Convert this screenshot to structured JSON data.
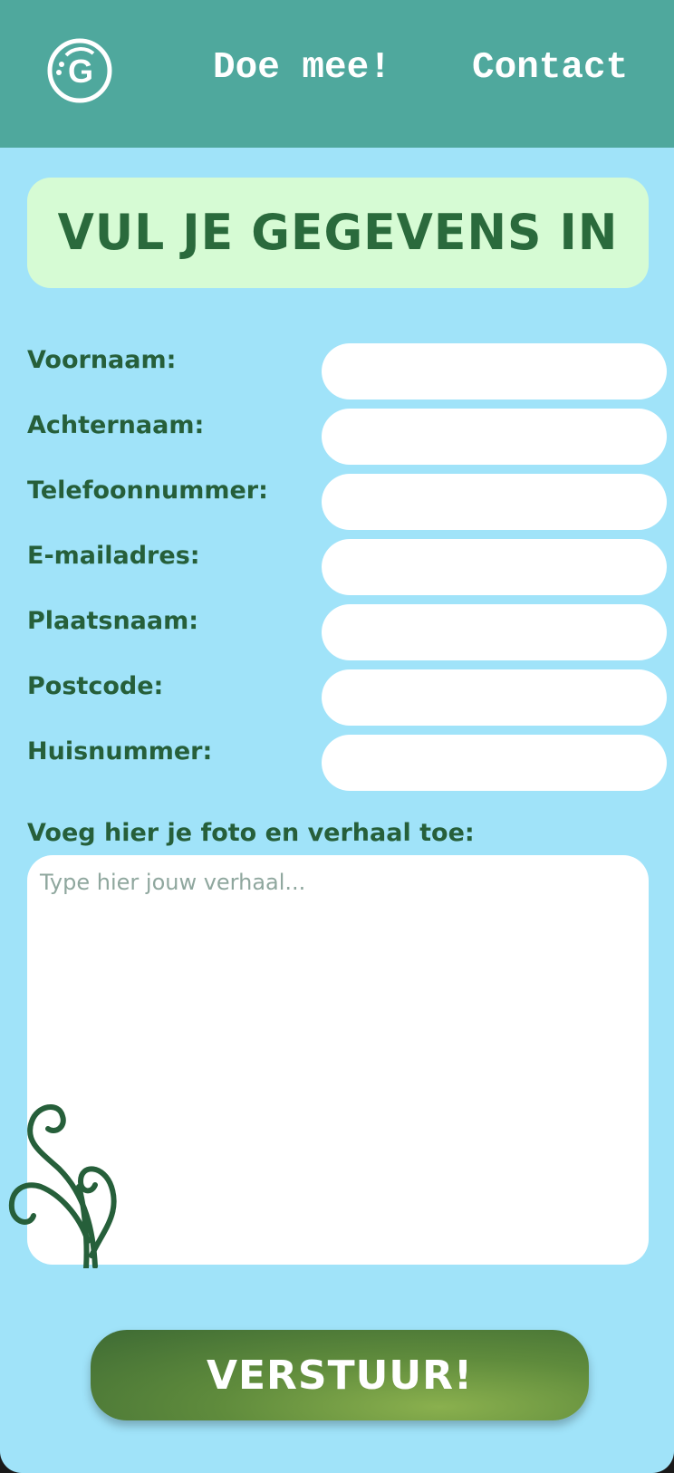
{
  "header": {
    "logo_letter": "G",
    "nav": [
      {
        "label": "Doe mee!"
      },
      {
        "label": "Contact"
      }
    ]
  },
  "form": {
    "title": "VUL JE GEGEVENS IN",
    "fields": [
      {
        "label": "Voornaam:",
        "value": ""
      },
      {
        "label": "Achternaam:",
        "value": ""
      },
      {
        "label": "Telefoonnummer:",
        "value": ""
      },
      {
        "label": "E-mailadres:",
        "value": ""
      },
      {
        "label": "Plaatsnaam:",
        "value": ""
      },
      {
        "label": "Postcode:",
        "value": ""
      },
      {
        "label": "Huisnummer:",
        "value": ""
      }
    ],
    "story_label": "Voeg hier je foto en verhaal toe:",
    "story_placeholder": "Type hier jouw verhaal...",
    "submit_label": "VERSTUUR!"
  },
  "colors": {
    "header_bg": "#4fa89d",
    "page_bg": "#a0e3f9",
    "title_bg": "#d6fbd4",
    "text_green": "#265f3a",
    "button_green": "#5f8b3c"
  }
}
